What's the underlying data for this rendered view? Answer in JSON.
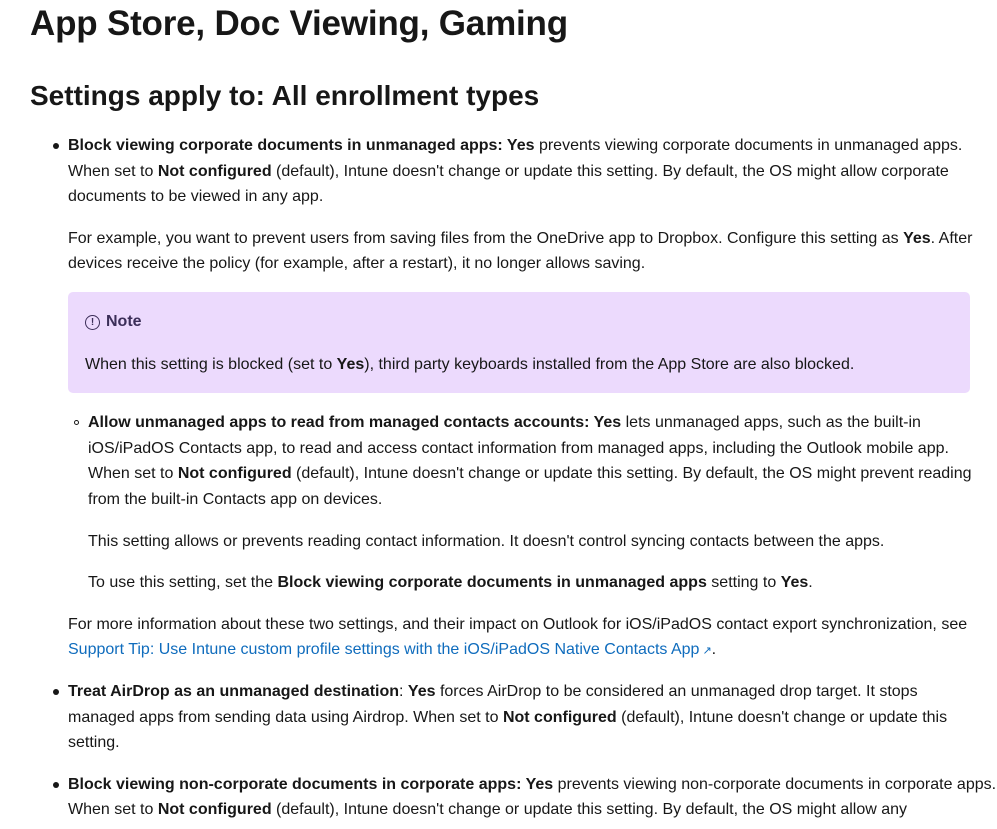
{
  "page_title": "App Store, Doc Viewing, Gaming",
  "section_heading": "Settings apply to: All enrollment types",
  "item1": {
    "name": "Block viewing corporate documents in unmanaged apps",
    "sep": ": ",
    "yes": "Yes",
    "line1_rest": " prevents viewing corporate documents in unmanaged apps.",
    "line2_a": "When set to ",
    "not_configured": "Not configured",
    "line2_b": " (default), Intune doesn't change or update this setting. By default, the OS might allow corporate",
    "line3": "documents to be viewed in any app."
  },
  "example": {
    "line1_a": "For example, you want to prevent users from saving files from the OneDrive app to Dropbox. Configure this setting as ",
    "yes": "Yes",
    "line1_b": ". After",
    "line2": "devices receive the policy (for example, after a restart), it no longer allows saving."
  },
  "note": {
    "title": "Note",
    "body_a": "When this setting is blocked (set to ",
    "yes": "Yes",
    "body_b": "), third party keyboards installed from the App Store are also blocked."
  },
  "subitem": {
    "name": "Allow unmanaged apps to read from managed contacts accounts",
    "sep": ": ",
    "yes": "Yes",
    "line1_rest": " lets unmanaged apps, such as the built-in",
    "line2": "iOS/iPadOS Contacts app, to read and access contact information from managed apps, including the Outlook mobile app.",
    "line3_a": "When set to ",
    "not_configured": "Not configured",
    "line3_b": " (default), Intune doesn't change or update this setting. By default, the OS might prevent reading",
    "line4": "from the built-in Contacts app on devices.",
    "para2": "This setting allows or prevents reading contact information. It doesn't control syncing contacts between the apps.",
    "para3_a": "To use this setting, set the ",
    "para3_bold": "Block viewing corporate documents in unmanaged apps",
    "para3_b": " setting to ",
    "para3_yes": "Yes",
    "para3_c": "."
  },
  "more_info": {
    "line1": "For more information about these two settings, and their impact on Outlook for iOS/iPadOS contact export synchronization, see",
    "link": "Support Tip: Use Intune custom profile settings with the iOS/iPadOS Native Contacts App",
    "ext_icon": "↗",
    "end": "."
  },
  "item2": {
    "name": "Treat AirDrop as an unmanaged destination",
    "sep": ": ",
    "yes": "Yes",
    "line1_rest": " forces AirDrop to be considered an unmanaged drop target. It stops",
    "line2_a": "managed apps from sending data using Airdrop. When set to ",
    "not_configured": "Not configured",
    "line2_b": " (default), Intune doesn't change or update this",
    "line3": "setting."
  },
  "item3": {
    "name": "Block viewing non-corporate documents in corporate apps",
    "sep": ": ",
    "yes": "Yes",
    "line1_rest": " prevents viewing non-corporate documents in corporate apps.",
    "line2_a": "When set to ",
    "not_configured": "Not configured",
    "line2_b": " (default), Intune doesn't change or update this setting. By default, the OS might allow any"
  },
  "icons": {
    "note_icon": "info-circle-icon",
    "external_link_icon": "external-link-icon"
  },
  "colors": {
    "link": "#0f6cbd",
    "note_bg": "#ecdafd",
    "note_title": "#3b2e58",
    "text": "#171717"
  }
}
